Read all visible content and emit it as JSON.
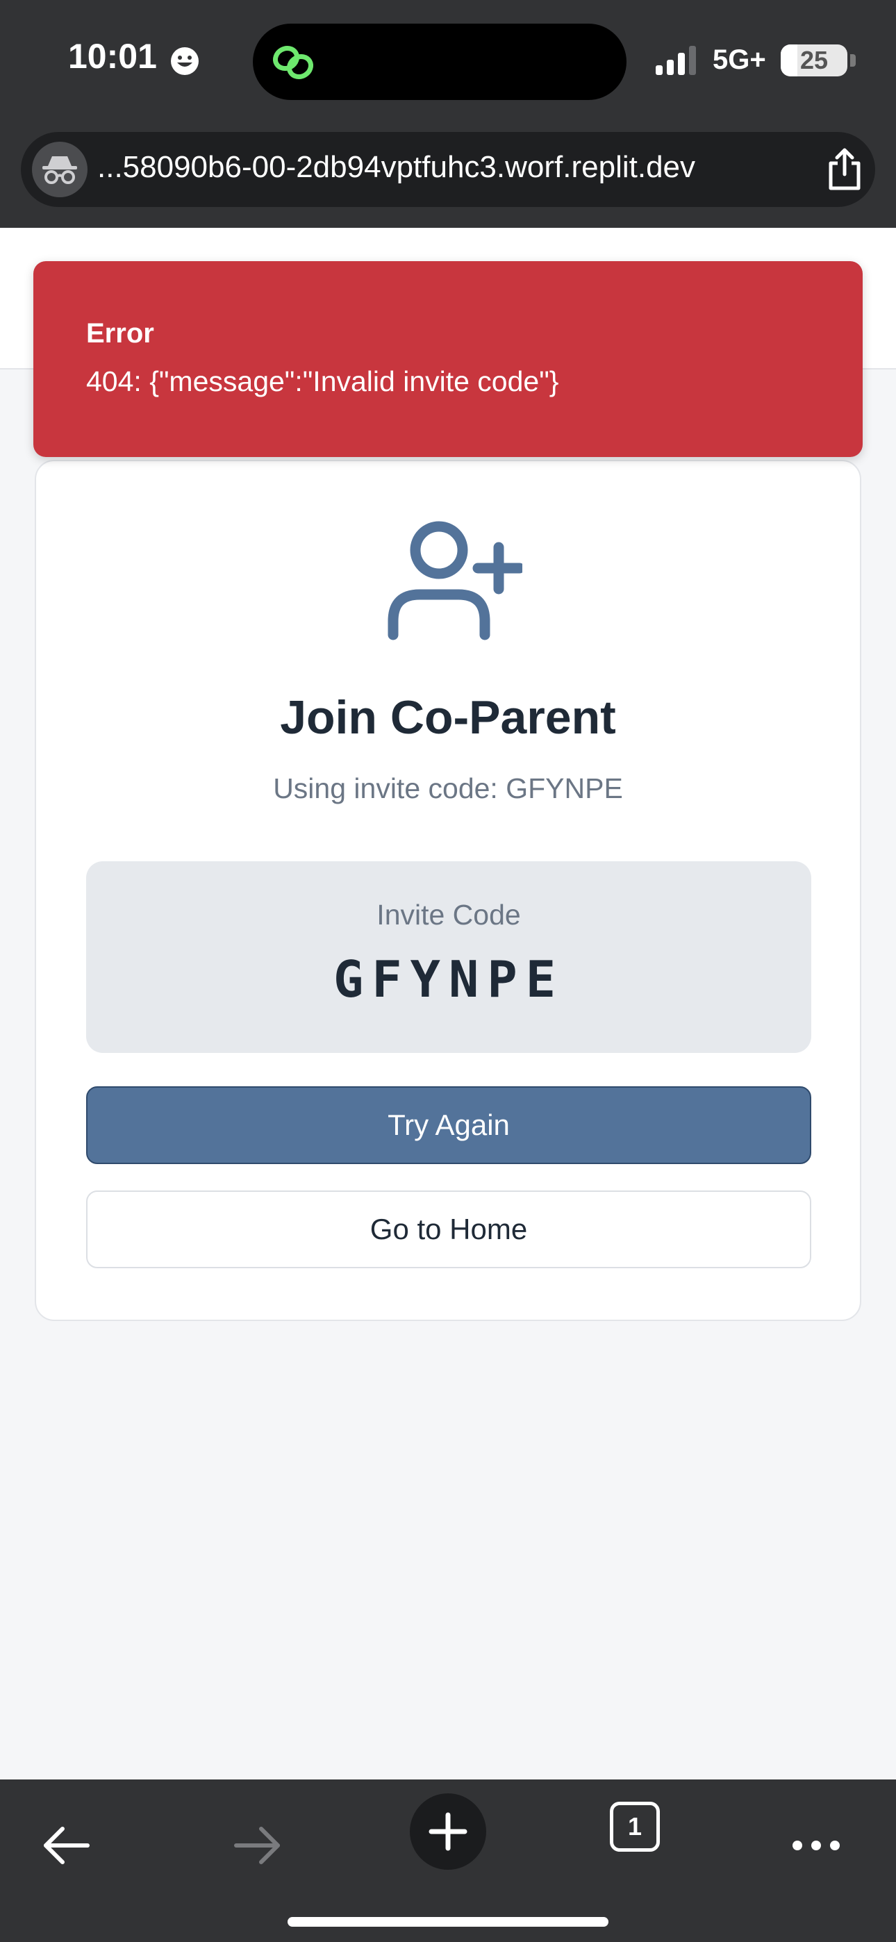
{
  "status_bar": {
    "time": "10:01",
    "network": "5G+",
    "battery": "25",
    "battery_fraction": 0.25
  },
  "browser": {
    "url": "...58090b6-00-2db94vptfuhc3.worf.replit.dev",
    "tab_count": "1",
    "icons": [
      "incognito-icon",
      "share-icon",
      "back-arrow-icon",
      "forward-arrow-icon",
      "plus-icon",
      "tabs-icon",
      "more-icon"
    ]
  },
  "toast": {
    "title": "Error",
    "message": "404: {\"message\":\"Invalid invite code\"}"
  },
  "card": {
    "title": "Join Co-Parent",
    "subtitle": "Using invite code: GFYNPE",
    "code_label": "Invite Code",
    "code_value": "GFYNPE",
    "primary_button": "Try Again",
    "secondary_button": "Go to Home"
  },
  "colors": {
    "error": "#c8363e",
    "accent": "#53739a",
    "chrome": "#323335"
  }
}
